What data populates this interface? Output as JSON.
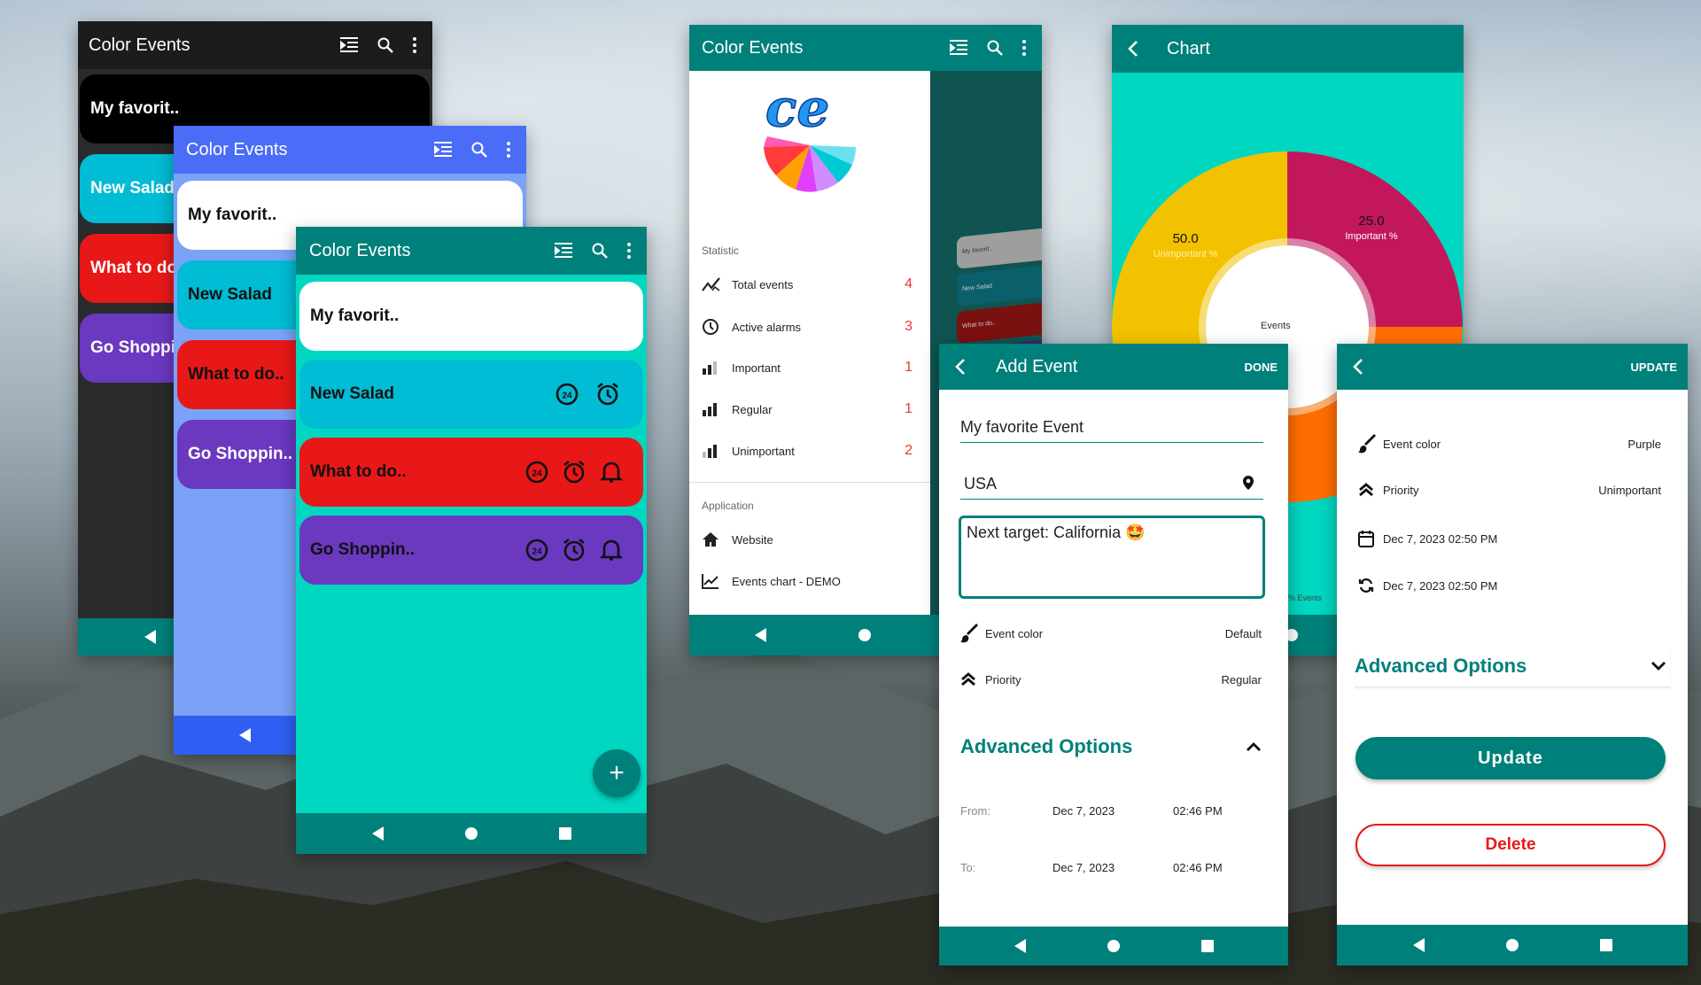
{
  "app_title": "Color Events",
  "screen_black": {
    "cards": [
      "My favorit..",
      "New Salad",
      "What to do",
      "Go Shoppi"
    ]
  },
  "screen_blue": {
    "cards": [
      "My favorit..",
      "New Salad",
      "What to do..",
      "Go Shoppin.."
    ]
  },
  "screen_main": {
    "cards": [
      "My favorit..",
      "New Salad",
      "What to do..",
      "Go Shoppin.."
    ],
    "fab": "+"
  },
  "drawer": {
    "logo_text": "ce",
    "statistic_header": "Statistic",
    "stats": [
      {
        "label": "Total events",
        "value": "4",
        "icon": "trend-icon"
      },
      {
        "label": "Active alarms",
        "value": "3",
        "icon": "clock-icon"
      },
      {
        "label": "Important",
        "value": "1",
        "icon": "signal-high-icon"
      },
      {
        "label": "Regular",
        "value": "1",
        "icon": "signal-mid-icon"
      },
      {
        "label": "Unimportant",
        "value": "2",
        "icon": "signal-low-icon"
      }
    ],
    "application_header": "Application",
    "app_items": [
      {
        "label": "Website",
        "icon": "home-icon"
      },
      {
        "label": "Events chart - DEMO",
        "icon": "chart-line-icon"
      }
    ],
    "peek_cards": [
      "My favorit..",
      "New Salad",
      "What to do.."
    ]
  },
  "chart_screen": {
    "title": "Chart",
    "center_label": "Events",
    "legend_partial": "t % Events"
  },
  "chart_data": {
    "type": "pie",
    "title": "Chart",
    "center_label": "Events",
    "slices": [
      {
        "label": "Important %",
        "value": 25.0,
        "color": "#c2185b"
      },
      {
        "label": "Unimportant %",
        "value": 50.0,
        "color": "#f2c200"
      },
      {
        "label": "",
        "value": 25.0,
        "color": "#ff6d00"
      }
    ]
  },
  "add_event": {
    "title": "Add Event",
    "done": "DONE",
    "name_value": "My favorite Event",
    "location_value": "USA",
    "note_value": "Next target: California 🤩",
    "event_color_label": "Event color",
    "event_color_value": "Default",
    "priority_label": "Priority",
    "priority_value": "Regular",
    "advanced": "Advanced Options",
    "from_label": "From:",
    "from_date": "Dec 7, 2023",
    "from_time": "02:46 PM",
    "to_label": "To:",
    "to_date": "Dec 7, 2023",
    "to_time": "02:46 PM"
  },
  "update_event": {
    "action": "UPDATE",
    "event_color_label": "Event color",
    "event_color_value": "Purple",
    "priority_label": "Priority",
    "priority_value": "Unimportant",
    "date1": "Dec 7, 2023  02:50 PM",
    "date2": "Dec 7, 2023  02:50 PM",
    "advanced": "Advanced Options",
    "update_btn": "Update",
    "delete_btn": "Delete"
  },
  "colors": {
    "teal": "#00807a",
    "turquoise": "#00d7c1",
    "cyan": "#00bcd4",
    "red": "#e81818",
    "purple": "#6b38c0",
    "blue_bar": "#4a6cf7",
    "blue_bg": "#7aa2f7"
  }
}
